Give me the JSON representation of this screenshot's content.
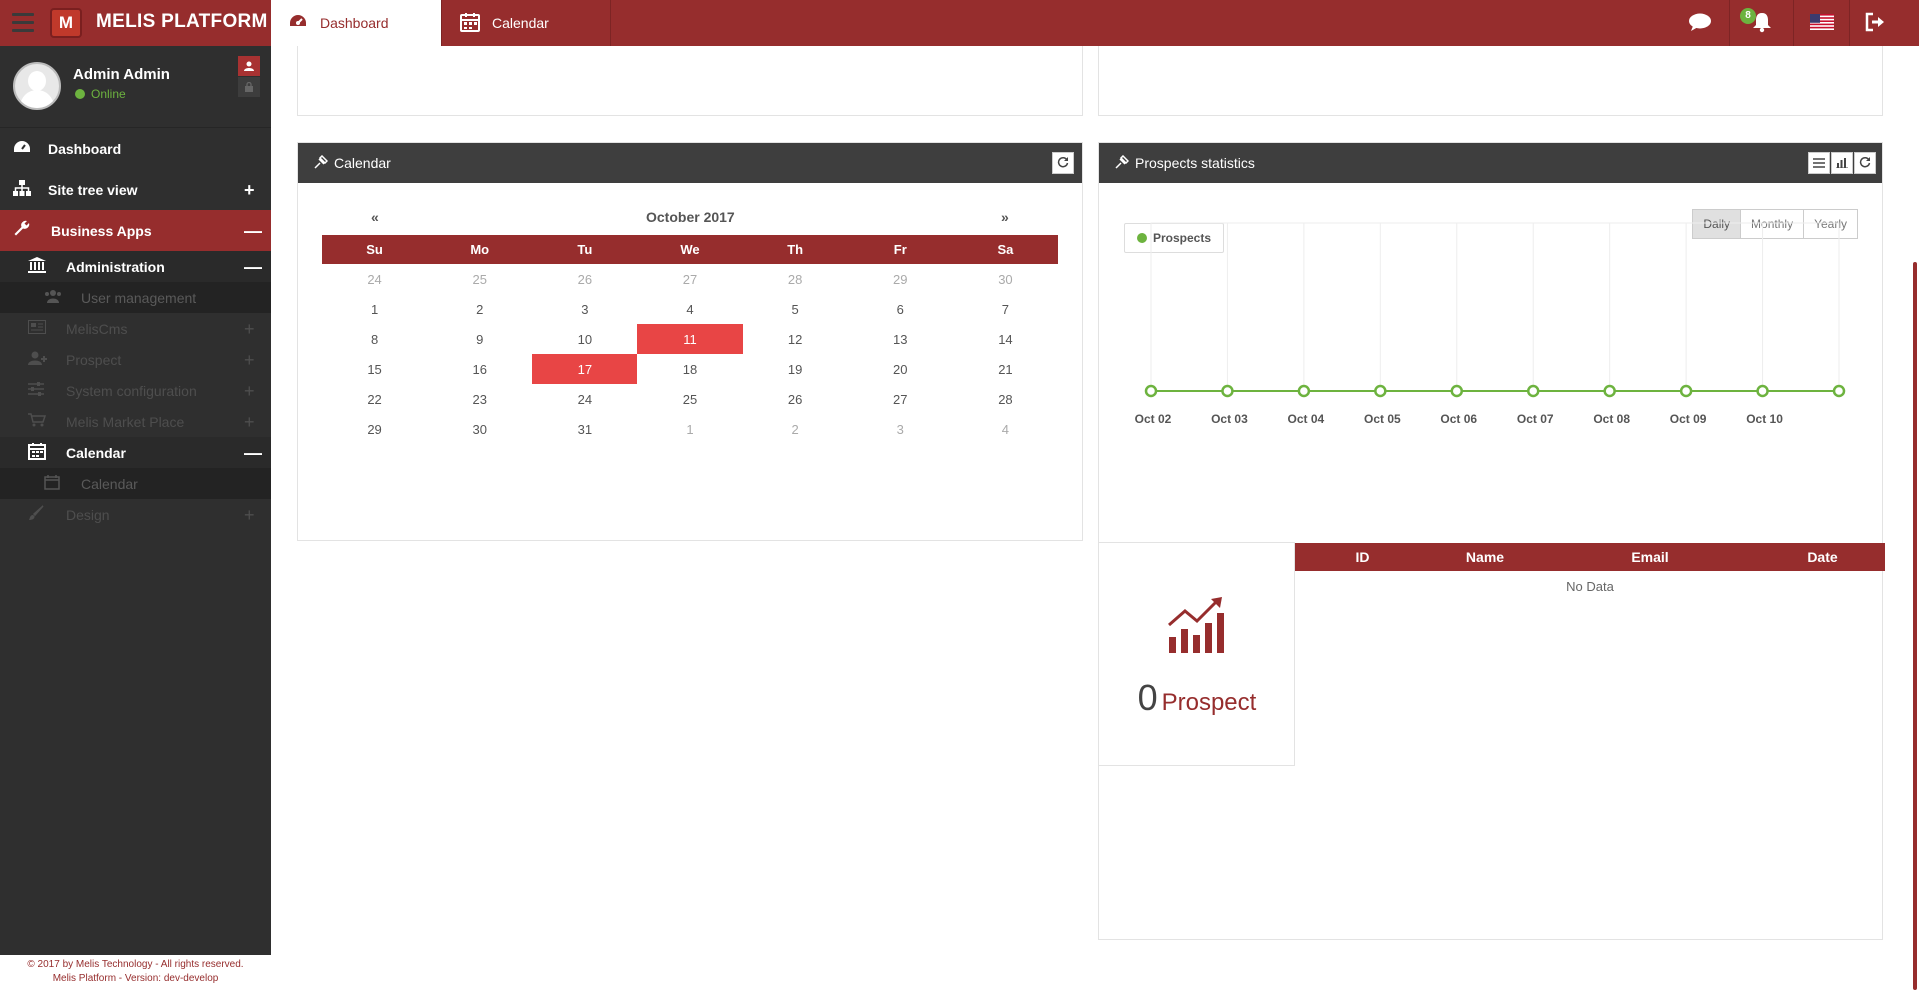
{
  "app": {
    "brand": "MELIS PLATFORM",
    "logo_letter": "M"
  },
  "tabs": [
    {
      "label": "Dashboard",
      "icon": "dashboard-icon",
      "active": true
    },
    {
      "label": "Calendar",
      "icon": "calendar-icon",
      "active": false
    }
  ],
  "header_right": {
    "notification_count": "8",
    "icons": [
      "chat-icon",
      "bell-icon",
      "us-flag-icon",
      "logout-icon"
    ]
  },
  "user": {
    "name": "Admin Admin",
    "status": "Online"
  },
  "sidebar": {
    "items": [
      {
        "label": "Dashboard",
        "icon": "dashboard-icon",
        "sign": ""
      },
      {
        "label": "Site tree view",
        "icon": "sitemap-icon",
        "sign": "+"
      },
      {
        "label": "Business Apps",
        "icon": "wrench-icon",
        "sign": "—"
      },
      {
        "label": "Administration",
        "icon": "bank-icon",
        "sign": "—"
      },
      {
        "label": "User management",
        "icon": "users-icon",
        "sign": ""
      },
      {
        "label": "MelisCms",
        "icon": "cms-icon",
        "sign": "+"
      },
      {
        "label": "Prospect",
        "icon": "add-user-icon",
        "sign": "+"
      },
      {
        "label": "System configuration",
        "icon": "sliders-icon",
        "sign": "+"
      },
      {
        "label": "Melis Market Place",
        "icon": "cart-icon",
        "sign": "+"
      },
      {
        "label": "Calendar",
        "icon": "calendar-icon",
        "sign": "—"
      },
      {
        "label": "Calendar",
        "icon": "calendar-icon",
        "sign": ""
      },
      {
        "label": "Design",
        "icon": "brush-icon",
        "sign": "+"
      }
    ],
    "footer_line1": "© 2017 by Melis Technology - All rights reserved.",
    "footer_line2": "Melis Platform - Version: dev-develop"
  },
  "calendar_widget": {
    "title": "Calendar",
    "month": "October 2017",
    "prev": "«",
    "next": "»",
    "weekdays": [
      "Su",
      "Mo",
      "Tu",
      "We",
      "Th",
      "Fr",
      "Sa"
    ],
    "weeks": [
      [
        "24",
        "25",
        "26",
        "27",
        "28",
        "29",
        "30"
      ],
      [
        "1",
        "2",
        "3",
        "4",
        "5",
        "6",
        "7"
      ],
      [
        "8",
        "9",
        "10",
        "11",
        "12",
        "13",
        "14"
      ],
      [
        "15",
        "16",
        "17",
        "18",
        "19",
        "20",
        "21"
      ],
      [
        "22",
        "23",
        "24",
        "25",
        "26",
        "27",
        "28"
      ],
      [
        "29",
        "30",
        "31",
        "1",
        "2",
        "3",
        "4"
      ]
    ],
    "highlighted_days": [
      "11",
      "17"
    ],
    "highlight_color": "#e84545"
  },
  "prospects_widget": {
    "title": "Prospects statistics",
    "legend": "Prospects",
    "periods": [
      "Daily",
      "Monthly",
      "Yearly"
    ],
    "active_period": "Daily",
    "count": "0",
    "count_label": "Prospect",
    "table_headers": [
      "ID",
      "Name",
      "Email",
      "Date"
    ],
    "empty_text": "No Data"
  },
  "chart_data": {
    "type": "line",
    "x": [
      "Oct 02",
      "Oct 03",
      "Oct 04",
      "Oct 05",
      "Oct 06",
      "Oct 07",
      "Oct 08",
      "Oct 09",
      "Oct 10",
      ""
    ],
    "series": [
      {
        "name": "Prospects",
        "values": [
          0,
          0,
          0,
          0,
          0,
          0,
          0,
          0,
          0,
          0
        ],
        "color": "#6db33f"
      }
    ],
    "grid": true,
    "legend_position": "top-left"
  },
  "colors": {
    "brand": "#962d2d",
    "sidebar": "#2f2f2f",
    "accent_green": "#6db33f"
  }
}
